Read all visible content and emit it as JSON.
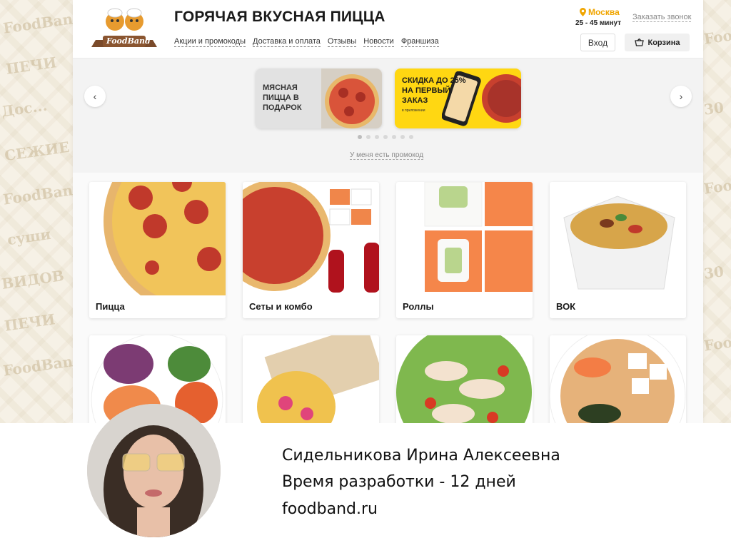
{
  "header": {
    "logo_text": "FoodBand",
    "title": "ГОРЯЧАЯ ВКУСНАЯ ПИЦЦА",
    "nav": [
      "Акции и промокоды",
      "Доставка и оплата",
      "Отзывы",
      "Новости",
      "Франшиза"
    ],
    "city": "Москва",
    "delivery_time": "25 - 45 минут",
    "callback": "Заказать звонок",
    "login": "Вход",
    "cart": "Корзина"
  },
  "banners": {
    "promo1": "МЯСНАЯ ПИЦЦА В ПОДАРОК",
    "promo2": "СКИДКА ДО 25% НА ПЕРВЫЙ ЗАКАЗ",
    "promo2_sub": "в приложении",
    "promo_code_link": "У меня есть промокод",
    "slide_count": 7,
    "active_slide": 1
  },
  "categories": [
    {
      "label": "Пицца",
      "icon": "pizza-image"
    },
    {
      "label": "Сеты и комбо",
      "icon": "combo-image"
    },
    {
      "label": "Роллы",
      "icon": "rolls-image"
    },
    {
      "label": "ВОК",
      "icon": "wok-image"
    },
    {
      "label": "",
      "icon": "poke-image"
    },
    {
      "label": "",
      "icon": "shawarma-image"
    },
    {
      "label": "",
      "icon": "salad-image"
    },
    {
      "label": "",
      "icon": "soup-image"
    }
  ],
  "caption": {
    "name": "Сидельникова Ирина Алексеевна",
    "dev_time": "Время разработки - 12 дней",
    "site": "foodband.ru"
  },
  "colors": {
    "accent": "#f0a500",
    "promo_yellow": "#ffd712"
  }
}
